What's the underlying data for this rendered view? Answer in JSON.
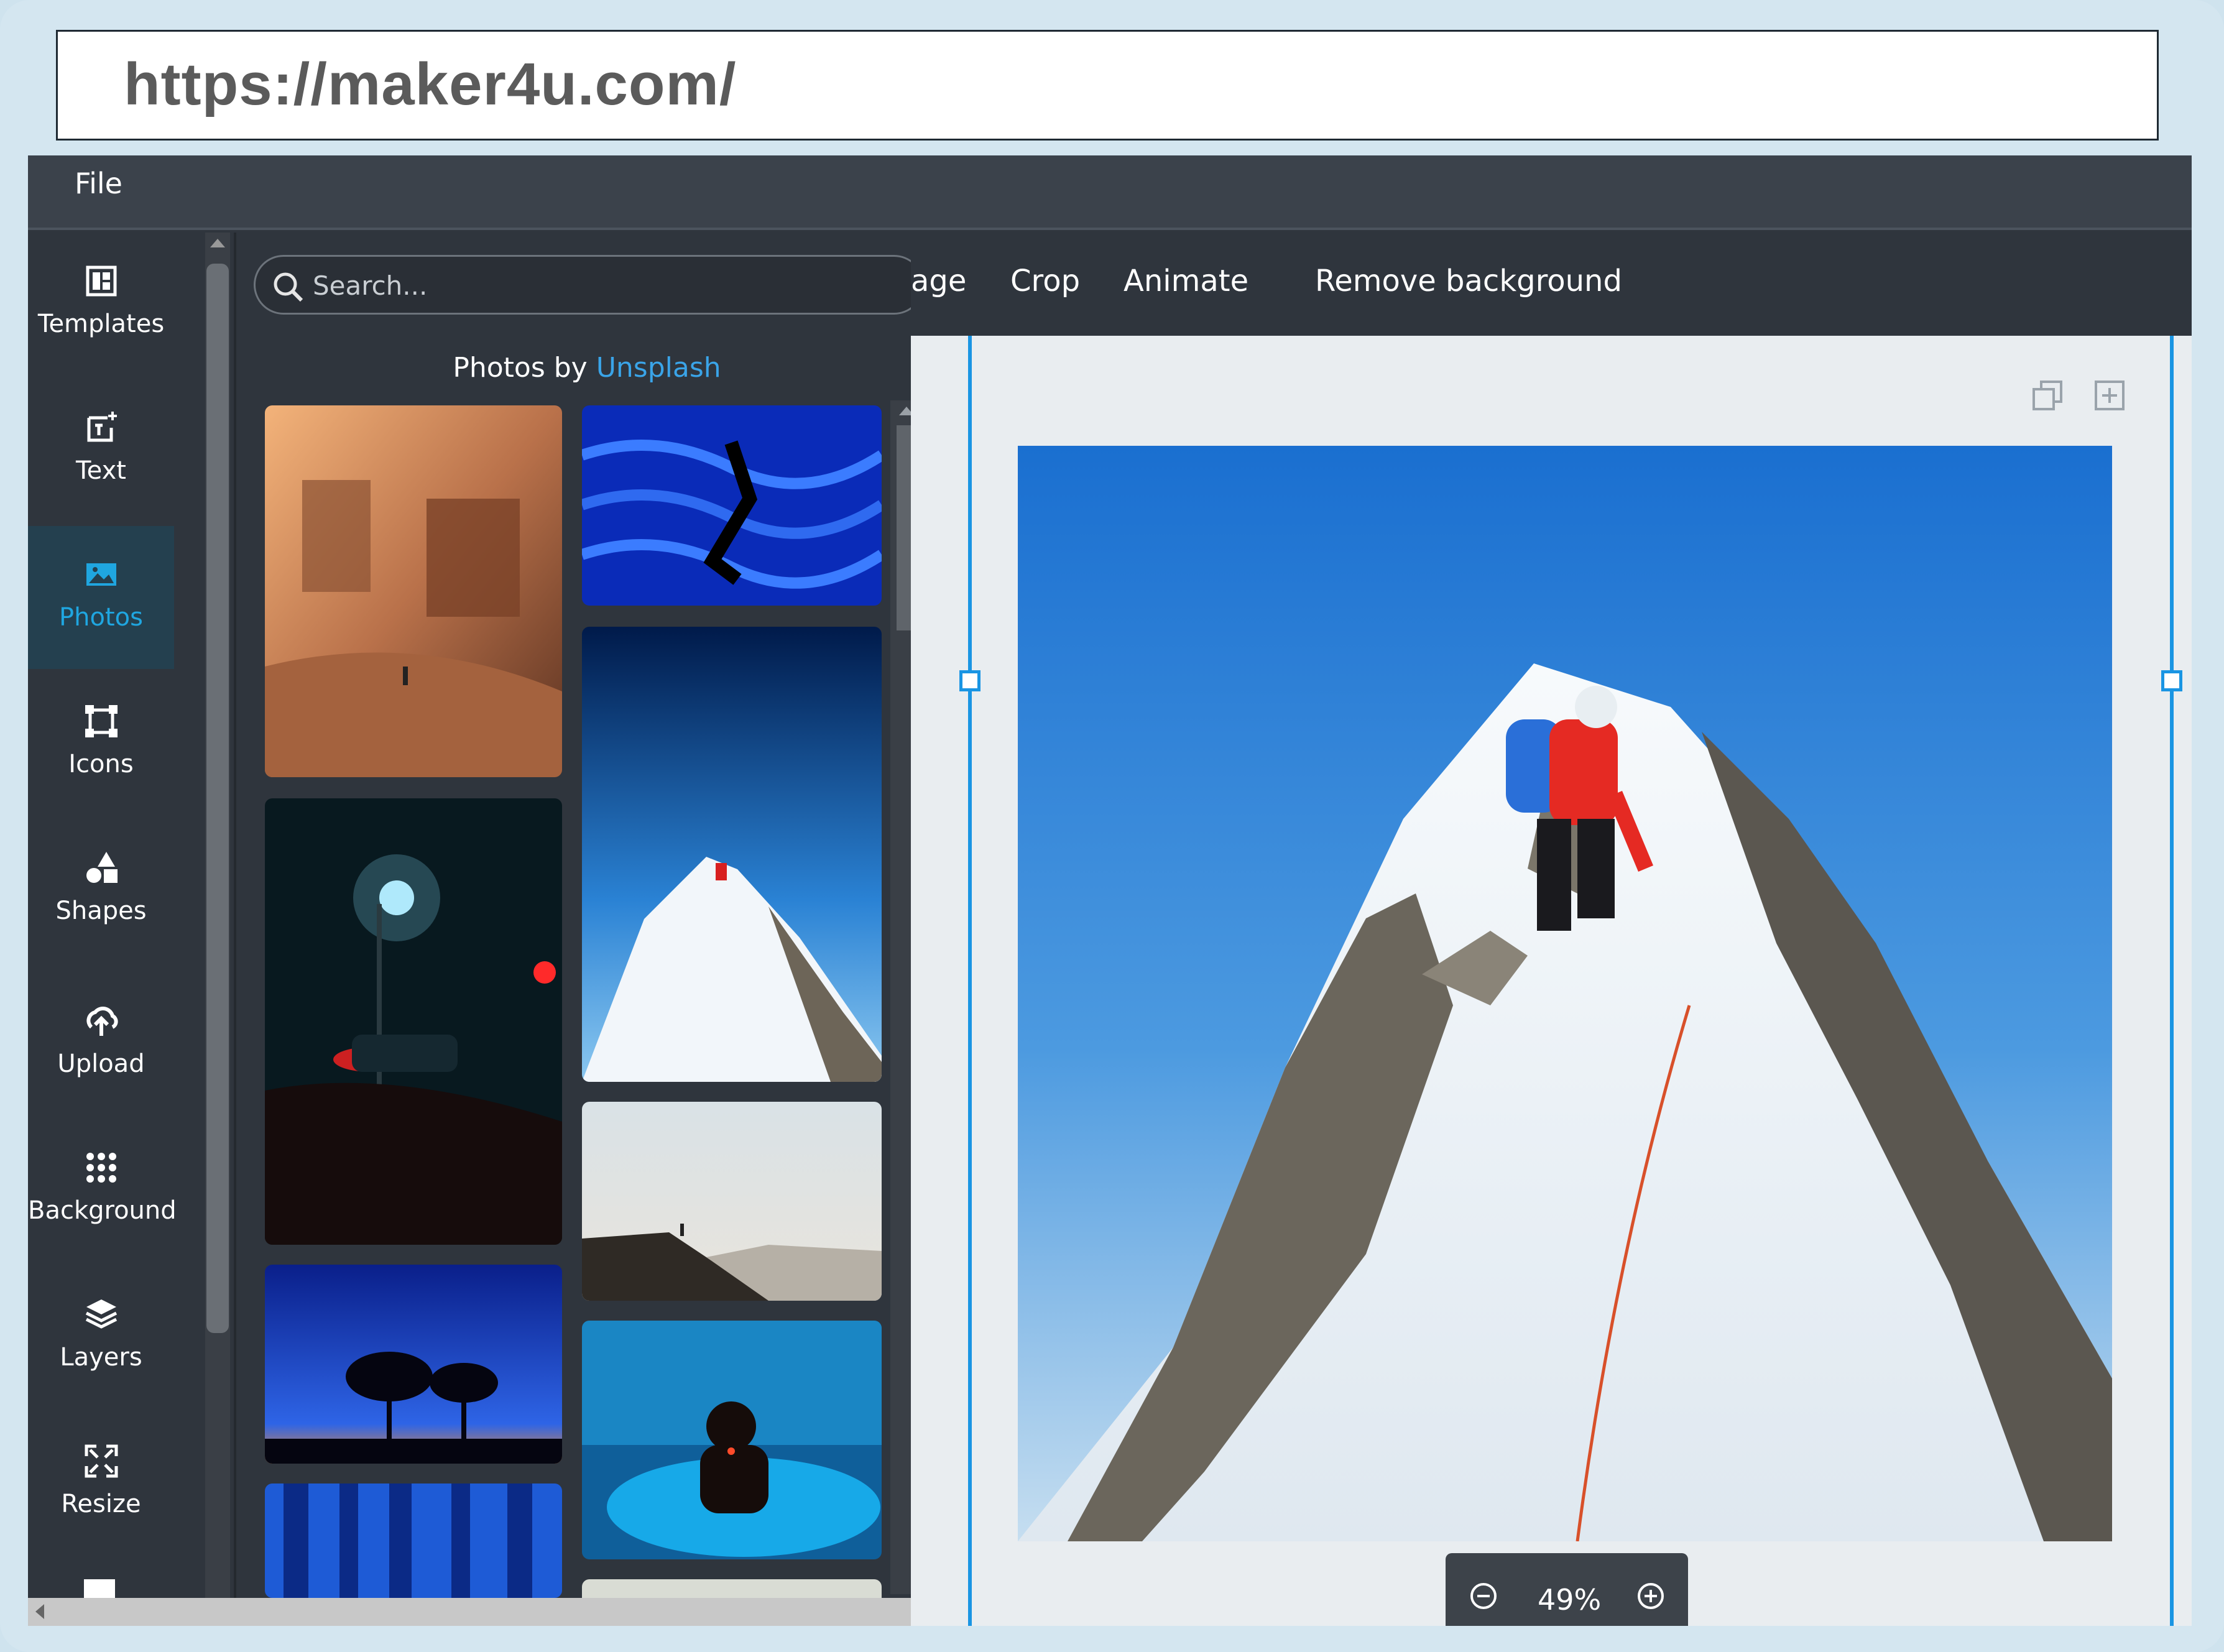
{
  "browser": {
    "url": "https://maker4u.com/"
  },
  "menubar": {
    "file_label": "File"
  },
  "sidebar": {
    "items": [
      {
        "label": "Templates",
        "icon": "templates-icon"
      },
      {
        "label": "Text",
        "icon": "text-icon"
      },
      {
        "label": "Photos",
        "icon": "photos-icon",
        "active": true
      },
      {
        "label": "Icons",
        "icon": "icons-icon"
      },
      {
        "label": "Shapes",
        "icon": "shapes-icon"
      },
      {
        "label": "Upload",
        "icon": "upload-icon"
      },
      {
        "label": "Background",
        "icon": "background-icon"
      },
      {
        "label": "Layers",
        "icon": "layers-icon"
      },
      {
        "label": "Resize",
        "icon": "resize-icon"
      }
    ]
  },
  "photos_panel": {
    "search_placeholder": "Search...",
    "credit_prefix": "Photos by",
    "credit_link": "Unsplash"
  },
  "toolbar": {
    "items": [
      "age",
      "Crop",
      "Animate",
      "Remove background"
    ]
  },
  "canvas": {
    "zoom": "49%"
  },
  "colors": {
    "accent": "#1a95e3",
    "active_text": "#1fa6e0",
    "link": "#3aa4e8"
  }
}
